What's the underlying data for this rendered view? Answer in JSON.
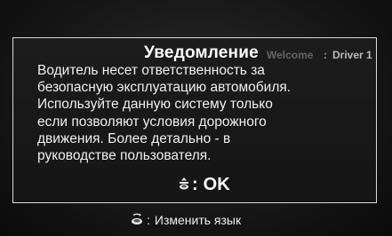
{
  "notice": {
    "title": "Уведомление",
    "welcome_label": "Welcome",
    "welcome_separator": ":",
    "driver": "Driver 1",
    "message_lines": [
      "Водитель несет ответственность за",
      "безопасную эксплуатацию автомобиля.",
      "Используйте данную систему только",
      "если позволяют условия дорожного",
      "движения. Более детально - в",
      "руководстве пользователя."
    ],
    "ok_icon": "interface-knob-press-icon",
    "ok_separator": ":",
    "ok_label": "OK"
  },
  "footer": {
    "icon": "interface-dial-rotate-icon",
    "separator": ":",
    "label": "Изменить язык"
  },
  "colors": {
    "background": "#181818",
    "border": "#d8d8d8",
    "text": "#f0f0f0",
    "welcome_dim": "#666666"
  }
}
